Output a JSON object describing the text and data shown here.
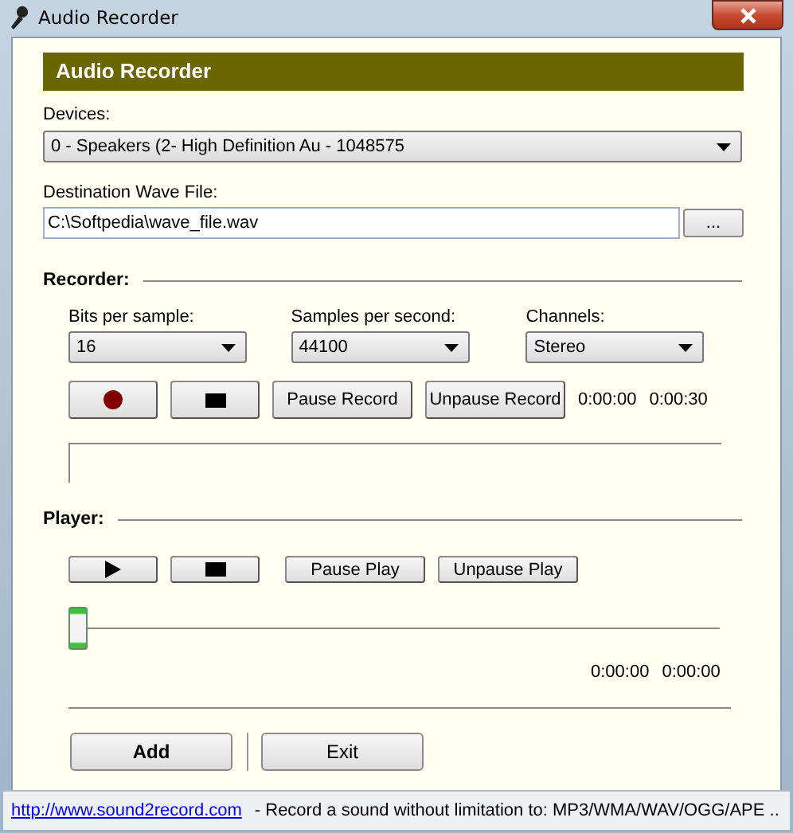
{
  "window": {
    "title": "Audio Recorder"
  },
  "header": "Audio Recorder",
  "devices": {
    "label": "Devices:",
    "value": "0 - Speakers (2- High Definition Au - 1048575"
  },
  "destination": {
    "label": "Destination Wave File:",
    "value": "C:\\Softpedia\\wave_file.wav",
    "browse": "..."
  },
  "recorder": {
    "title": "Recorder:",
    "settings": [
      {
        "label": "Bits per sample:",
        "value": "16"
      },
      {
        "label": "Samples per second:",
        "value": "44100"
      },
      {
        "label": "Channels:",
        "value": "Stereo"
      }
    ],
    "buttons": [
      {
        "kind": "record"
      },
      {
        "kind": "stop"
      },
      {
        "kind": "text",
        "label": "Pause Record"
      },
      {
        "kind": "text",
        "label": "Unpause Record"
      }
    ],
    "elapsed": "0:00:00",
    "total": "0:00:30"
  },
  "player": {
    "title": "Player:",
    "buttons": [
      {
        "kind": "play"
      },
      {
        "kind": "stop"
      },
      {
        "kind": "text",
        "label": "Pause Play"
      },
      {
        "kind": "text",
        "label": "Unpause Play"
      }
    ],
    "position": {
      "level": 0
    },
    "elapsed": "0:00:00",
    "total": "0:00:00"
  },
  "actions": [
    {
      "label": "Add",
      "default": true
    },
    {
      "label": "Exit",
      "default": false
    }
  ],
  "status_bar": {
    "link": "http://www.sound2record.com",
    "message": "- Record a sound without limitation to: MP3/WMA/WAV/OGG/APE .."
  }
}
